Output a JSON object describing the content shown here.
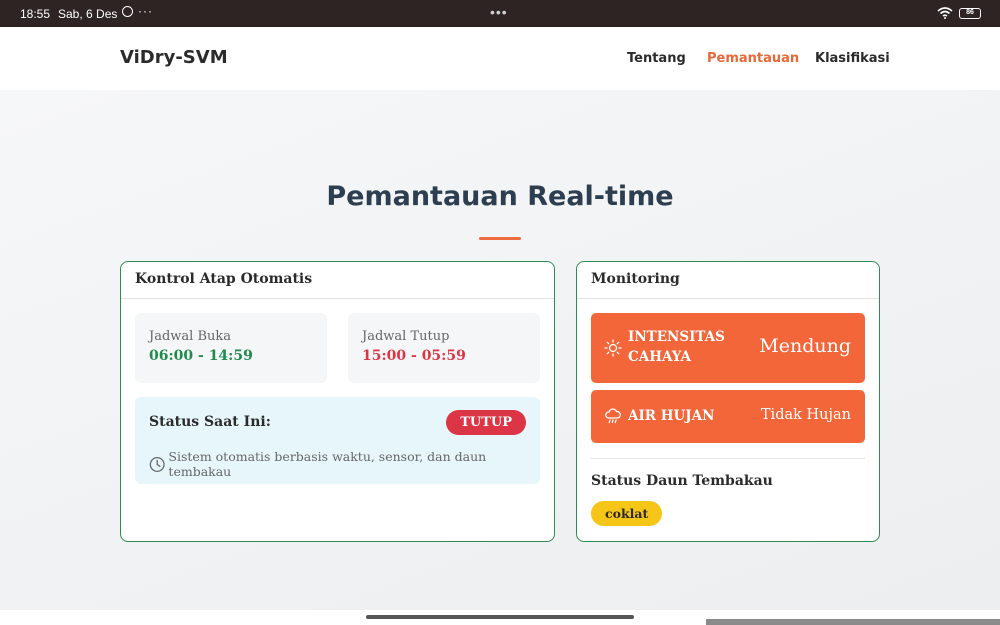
{
  "status_bar": {
    "time": "18:55",
    "date": "Sab, 6 Des",
    "more": "···",
    "center_dots": "•••",
    "battery": "86",
    "icons": [
      "whatsapp-icon",
      "wifi-icon",
      "battery-icon"
    ]
  },
  "navbar": {
    "brand": "ViDry-SVM",
    "links": [
      {
        "label": "Tentang",
        "active": false
      },
      {
        "label": "Pemantauan",
        "active": true
      },
      {
        "label": "Klasifikasi",
        "active": false
      }
    ],
    "active_color": "#e8683a"
  },
  "page": {
    "title": "Pemantauan Real-time",
    "accent_color": "#ee6a3f"
  },
  "roof_control": {
    "title": "Kontrol Atap Otomatis",
    "open_schedule": {
      "label": "Jadwal Buka",
      "value": "06:00 - 14:59",
      "color": "#1e8a4c"
    },
    "close_schedule": {
      "label": "Jadwal Tutup",
      "value": "15:00 - 05:59",
      "color": "#dc3545"
    },
    "status": {
      "label": "Status Saat Ini:",
      "badge": "TUTUP",
      "badge_color": "#dc3545",
      "note": "Sistem otomatis berbasis waktu, sensor, dan daun tembakau",
      "note_icon": "clock-icon"
    }
  },
  "monitoring": {
    "title": "Monitoring",
    "tiles": [
      {
        "icon": "sun-icon",
        "label": "INTENSITAS CAHAYA",
        "value": "Mendung"
      },
      {
        "icon": "cloud-rain-icon",
        "label": "AIR HUJAN",
        "value": "Tidak Hujan"
      }
    ],
    "tile_color": "#f2663a",
    "leaf": {
      "title": "Status Daun Tembakau",
      "badge": "coklat",
      "badge_color": "#f5c518"
    }
  }
}
